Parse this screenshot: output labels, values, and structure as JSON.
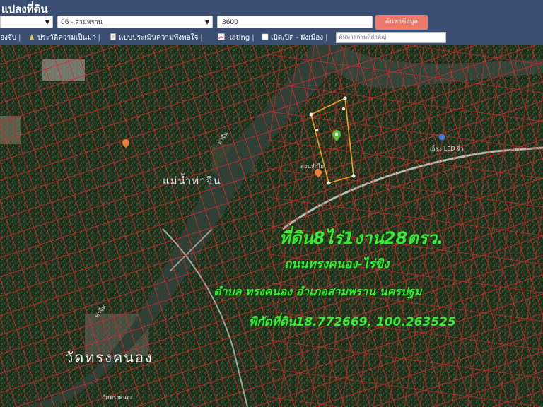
{
  "header": {
    "title": "แปลงที่ดิน"
  },
  "form": {
    "province_select": "",
    "district_select": "06 - สามพราน",
    "parcel_input": "3600",
    "search_button": "ค้นหาข้อมูล"
  },
  "toolbar": {
    "item_1": "องจับ",
    "item_2": "ประวัติความเป็นมา",
    "item_3": "แบบประเมินความพึงพอใจ",
    "item_4": "Rating",
    "item_5": "เปิด/ปิด - ผังเมือง",
    "search_placeholder": "ค้นหาสถานที่สำคัญ"
  },
  "map": {
    "river_label": "แม่น้ำท่าจีน",
    "river_small_1": "ท่าจีน",
    "river_small_2": "ท่าจีน",
    "temple_label": "วัดทรงคนอง",
    "temple_small": "วัดทรงคนอง",
    "place_label_1": "เอ็ชะ LED จิ๋ว",
    "place_label_2": "สวนลำไย"
  },
  "overlay": {
    "line_1": "ที่ดิน8ไร่1งาน28ตรว.",
    "line_2": "ถนนทรงคนอง-ไร่ขิง",
    "line_3": "ตำบล ทรงคนอง อำเภอสามพราน นครปฐม",
    "line_4": "พิกัดที่ดิน18.772669, 100.263525"
  },
  "colors": {
    "header_bg": "#3b4f73",
    "button_bg": "#f0786a",
    "overlay_text": "#3ee83a",
    "parcel_lines": "#d42a2a",
    "highlight_parcel": "#f0a020"
  }
}
